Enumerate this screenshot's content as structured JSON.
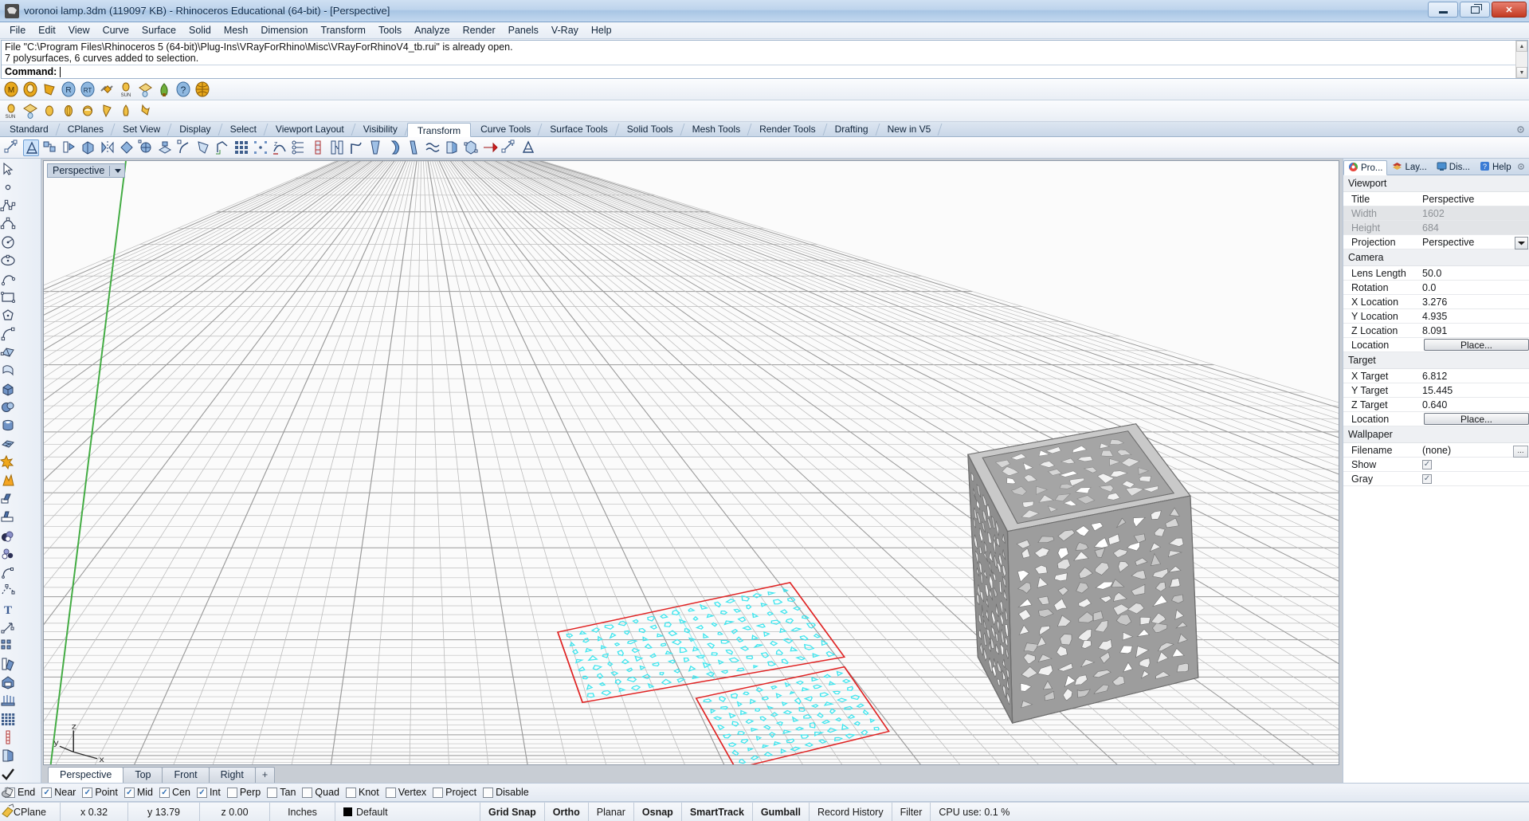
{
  "window": {
    "title": "voronoi lamp.3dm (119097 KB) - Rhinoceros Educational (64-bit) - [Perspective]",
    "app_icon": "rhino-icon",
    "minimize": "minimize-icon",
    "maximize": "restore-icon",
    "close": "close-icon"
  },
  "menu": {
    "items": [
      "File",
      "Edit",
      "View",
      "Curve",
      "Surface",
      "Solid",
      "Mesh",
      "Dimension",
      "Transform",
      "Tools",
      "Analyze",
      "Render",
      "Panels",
      "V-Ray",
      "Help"
    ]
  },
  "command": {
    "history": [
      "File \"C:\\Program Files\\Rhinoceros 5 (64-bit)\\Plug-Ins\\VRayForRhino\\Misc\\VRayForRhinoV4_tb.rui\" is already open.",
      "7 polysurfaces, 6 curves added to selection."
    ],
    "prompt_label": "Command:",
    "input_value": ""
  },
  "vray_toolbar": {
    "icons": [
      "vray-material-editor-icon",
      "vray-options-icon",
      "vray-light-lister-icon",
      "vray-render-icon",
      "vray-render-rt-icon",
      "vray-frame-buffer-icon",
      "vray-sun-icon",
      "vray-dome-light-icon",
      "vray-proxy-icon",
      "vray-help-icon",
      "vray-globe-icon"
    ]
  },
  "sun_toolbar": {
    "icons": [
      "sun-icon",
      "dome-light-icon",
      "rectangle-light-icon",
      "sphere-light-icon",
      "spot-light-icon",
      "ies-light-icon",
      "mesh-light-icon",
      "light-arrow-icon"
    ]
  },
  "tabs": {
    "items": [
      {
        "label": "Standard",
        "active": false
      },
      {
        "label": "CPlanes",
        "active": false
      },
      {
        "label": "Set View",
        "active": false
      },
      {
        "label": "Display",
        "active": false
      },
      {
        "label": "Select",
        "active": false
      },
      {
        "label": "Viewport Layout",
        "active": false
      },
      {
        "label": "Visibility",
        "active": false
      },
      {
        "label": "Transform",
        "active": true
      },
      {
        "label": "Curve Tools",
        "active": false
      },
      {
        "label": "Surface Tools",
        "active": false
      },
      {
        "label": "Solid Tools",
        "active": false
      },
      {
        "label": "Mesh Tools",
        "active": false
      },
      {
        "label": "Render Tools",
        "active": false
      },
      {
        "label": "Drafting",
        "active": false
      },
      {
        "label": "New in V5",
        "active": false
      }
    ],
    "options_icon": "gear-icon"
  },
  "transform_toolbar": {
    "icons": [
      "move-icon",
      "gumball-icon",
      "copy-icon",
      "rotate-2d-icon",
      "rotate-3d-icon",
      "mirror-icon",
      "scale-2d-icon",
      "scale-3d-icon",
      "scale-1d-icon",
      "shear-icon",
      "taper-icon",
      "bend-icon",
      "orient-icon",
      "array-rect-icon",
      "array-polar-icon",
      "array-curve-icon",
      "flow-along-curve-icon",
      "twist-icon",
      "project-to-cplane-icon",
      "smooth-icon",
      "set-points-icon",
      "split-icon",
      "trim-icon",
      "offset-icon",
      "blend-icon",
      "cage-edit-icon",
      "soft-edit-icon",
      "transform-arrow-icon"
    ],
    "selected_index": 1
  },
  "left_toolbar": {
    "icons": [
      [
        "select-objects-icon",
        "point-icon"
      ],
      [
        "polyline-icon",
        "control-point-curve-icon"
      ],
      [
        "circle-icon",
        "ellipse-icon"
      ],
      [
        "arc-icon",
        "rectangle-icon"
      ],
      [
        "polygon-icon",
        "curve-tools-icon"
      ],
      [
        "surface-from-points-icon",
        "extrude-surface-icon"
      ],
      [
        "box-icon",
        "sphere-icon"
      ],
      [
        "cylinder-icon",
        "surface-tools-icon"
      ],
      [
        "boolean-union-icon",
        "explode-icon"
      ],
      [
        "trim-icon",
        "split-icon"
      ],
      [
        "boolean-ops-icon",
        "boolean-difference-icon"
      ],
      [
        "fillet-icon",
        "offset-curve-icon"
      ],
      [
        "text-icon",
        "dimension-icon"
      ],
      [
        "array-icon",
        "mirror-icon"
      ],
      [
        "cap-icon",
        "extrude-icon"
      ],
      [
        "grid-points-icon",
        "rebuild-icon"
      ],
      [
        "layers-icon",
        "check-icon"
      ],
      [
        "shade-icon",
        "render-icon"
      ]
    ]
  },
  "viewport": {
    "label": "Perspective",
    "dropdown_icon": "chevron-down-icon",
    "axis_labels": {
      "x": "x",
      "y": "y",
      "z": "z"
    },
    "tabs": [
      {
        "label": "Perspective",
        "active": true
      },
      {
        "label": "Top",
        "active": false
      },
      {
        "label": "Front",
        "active": false
      },
      {
        "label": "Right",
        "active": false
      },
      {
        "label": "+",
        "active": false
      }
    ]
  },
  "right_panel": {
    "tabs": [
      {
        "label": "Pro...",
        "icon": "properties-icon",
        "active": true
      },
      {
        "label": "Lay...",
        "icon": "layers-icon",
        "active": false
      },
      {
        "label": "Dis...",
        "icon": "display-icon",
        "active": false
      },
      {
        "label": "Help",
        "icon": "help-icon",
        "active": false
      }
    ],
    "options_icon": "gear-icon",
    "groups": [
      {
        "title": "Viewport",
        "rows": [
          {
            "key": "Title",
            "value": "Perspective",
            "type": "text",
            "dim": false
          },
          {
            "key": "Width",
            "value": "1602",
            "type": "text",
            "dim": true
          },
          {
            "key": "Height",
            "value": "684",
            "type": "text",
            "dim": true
          },
          {
            "key": "Projection",
            "value": "Perspective",
            "type": "dropdown",
            "dim": false
          }
        ]
      },
      {
        "title": "Camera",
        "rows": [
          {
            "key": "Lens Length",
            "value": "50.0",
            "type": "text",
            "dim": false
          },
          {
            "key": "Rotation",
            "value": "0.0",
            "type": "text",
            "dim": false
          },
          {
            "key": "X Location",
            "value": "3.276",
            "type": "text",
            "dim": false
          },
          {
            "key": "Y Location",
            "value": "4.935",
            "type": "text",
            "dim": false
          },
          {
            "key": "Z Location",
            "value": "8.091",
            "type": "text",
            "dim": false
          },
          {
            "key": "Location",
            "value": "Place...",
            "type": "button",
            "dim": false
          }
        ]
      },
      {
        "title": "Target",
        "rows": [
          {
            "key": "X Target",
            "value": "6.812",
            "type": "text",
            "dim": false
          },
          {
            "key": "Y Target",
            "value": "15.445",
            "type": "text",
            "dim": false
          },
          {
            "key": "Z Target",
            "value": "0.640",
            "type": "text",
            "dim": false
          },
          {
            "key": "Location",
            "value": "Place...",
            "type": "button",
            "dim": false
          }
        ]
      },
      {
        "title": "Wallpaper",
        "rows": [
          {
            "key": "Filename",
            "value": "(none)",
            "type": "browse",
            "dim": false
          },
          {
            "key": "Show",
            "value": "",
            "type": "checkbox",
            "checked": true,
            "dim": false
          },
          {
            "key": "Gray",
            "value": "",
            "type": "checkbox",
            "checked": true,
            "dim": false
          }
        ]
      }
    ]
  },
  "osnap": {
    "items": [
      {
        "label": "End",
        "checked": true
      },
      {
        "label": "Near",
        "checked": true
      },
      {
        "label": "Point",
        "checked": true
      },
      {
        "label": "Mid",
        "checked": true
      },
      {
        "label": "Cen",
        "checked": true
      },
      {
        "label": "Int",
        "checked": true
      },
      {
        "label": "Perp",
        "checked": false
      },
      {
        "label": "Tan",
        "checked": false
      },
      {
        "label": "Quad",
        "checked": false
      },
      {
        "label": "Knot",
        "checked": false
      },
      {
        "label": "Vertex",
        "checked": false
      },
      {
        "label": "Project",
        "checked": false
      },
      {
        "label": "Disable",
        "checked": false
      }
    ]
  },
  "status": {
    "cplane": "CPlane",
    "x": "x 0.32",
    "y": "y 13.79",
    "z": "z 0.00",
    "units": "Inches",
    "layer": "Default",
    "layer_color": "#000000",
    "toggles": [
      {
        "label": "Grid Snap",
        "on": true
      },
      {
        "label": "Ortho",
        "on": true
      },
      {
        "label": "Planar",
        "on": false
      },
      {
        "label": "Osnap",
        "on": true
      },
      {
        "label": "SmartTrack",
        "on": true
      },
      {
        "label": "Gumball",
        "on": true
      },
      {
        "label": "Record History",
        "on": false
      },
      {
        "label": "Filter",
        "on": false
      }
    ],
    "cpu": "CPU use: 0.1 %"
  },
  "colors": {
    "accent": "#2f6fb5",
    "selection_red": "#e02222",
    "selection_cyan": "#3fe6ef",
    "model_gray": "#9a9a9a",
    "grid_gray": "#a8a8a8",
    "cplane_green": "#3aa83a"
  }
}
